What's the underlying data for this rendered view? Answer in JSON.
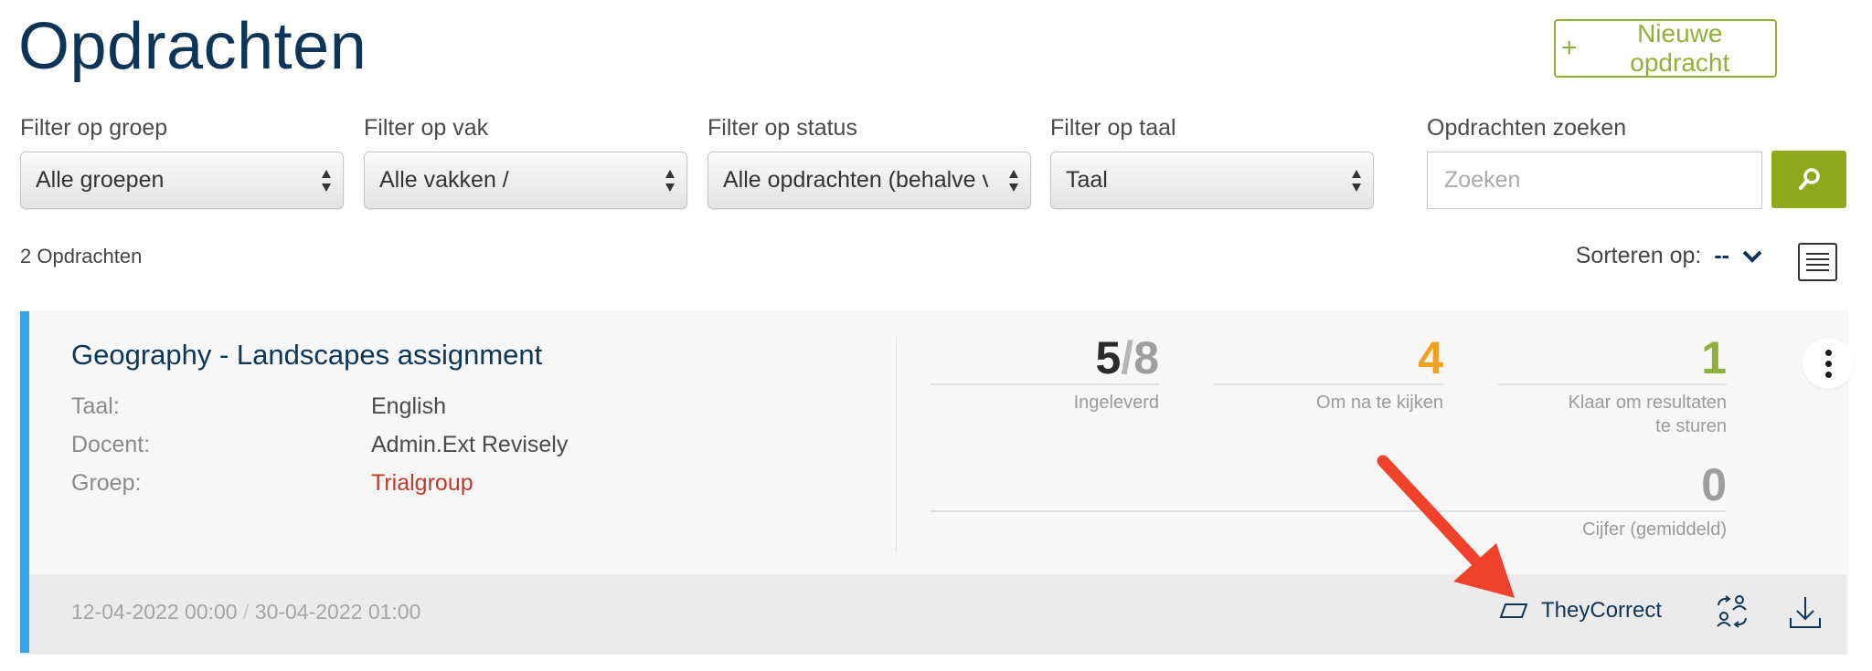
{
  "header": {
    "title": "Opdrachten",
    "new_button": "Nieuwe opdracht",
    "new_icon": "+"
  },
  "filters": [
    {
      "label": "Filter op groep",
      "value": "Alle groepen"
    },
    {
      "label": "Filter op vak",
      "value": "Alle vakken /"
    },
    {
      "label": "Filter op status",
      "value": "Alle opdrachten (behalve vo"
    },
    {
      "label": "Filter op taal",
      "value": "Taal"
    }
  ],
  "search": {
    "label": "Opdrachten zoeken",
    "placeholder": "Zoeken"
  },
  "list": {
    "count": "2 Opdrachten",
    "sort_label": "Sorteren op:",
    "sort_value": "--"
  },
  "assignment": {
    "title": "Geography - Landscapes assignment",
    "meta": [
      {
        "key": "Taal:",
        "value": "English"
      },
      {
        "key": "Docent:",
        "value": "Admin.Ext Revisely"
      },
      {
        "key": "Groep:",
        "value": "Trialgroup"
      }
    ],
    "stats": {
      "submitted": "5",
      "total": "8",
      "submitted_label": "Ingeleverd",
      "to_review": "4",
      "to_review_label": "Om na te kijken",
      "ready": "1",
      "ready_label": "Klaar om resultaten te sturen",
      "grade": "0",
      "grade_label": "Cijfer (gemiddeld)"
    },
    "start_date": "12-04-2022 00:00",
    "date_sep": "/",
    "end_date": "30-04-2022 01:00",
    "theycorrect_label": "TheyCorrect"
  },
  "colors": {
    "accent_green": "#8ea81c",
    "title_navy": "#0e3557",
    "card_border_blue": "#35a4e6",
    "review_orange": "#f0a11f",
    "ready_green": "#8fb03a",
    "group_red": "#c0392b",
    "annotation_arrow": "#f0412b"
  }
}
